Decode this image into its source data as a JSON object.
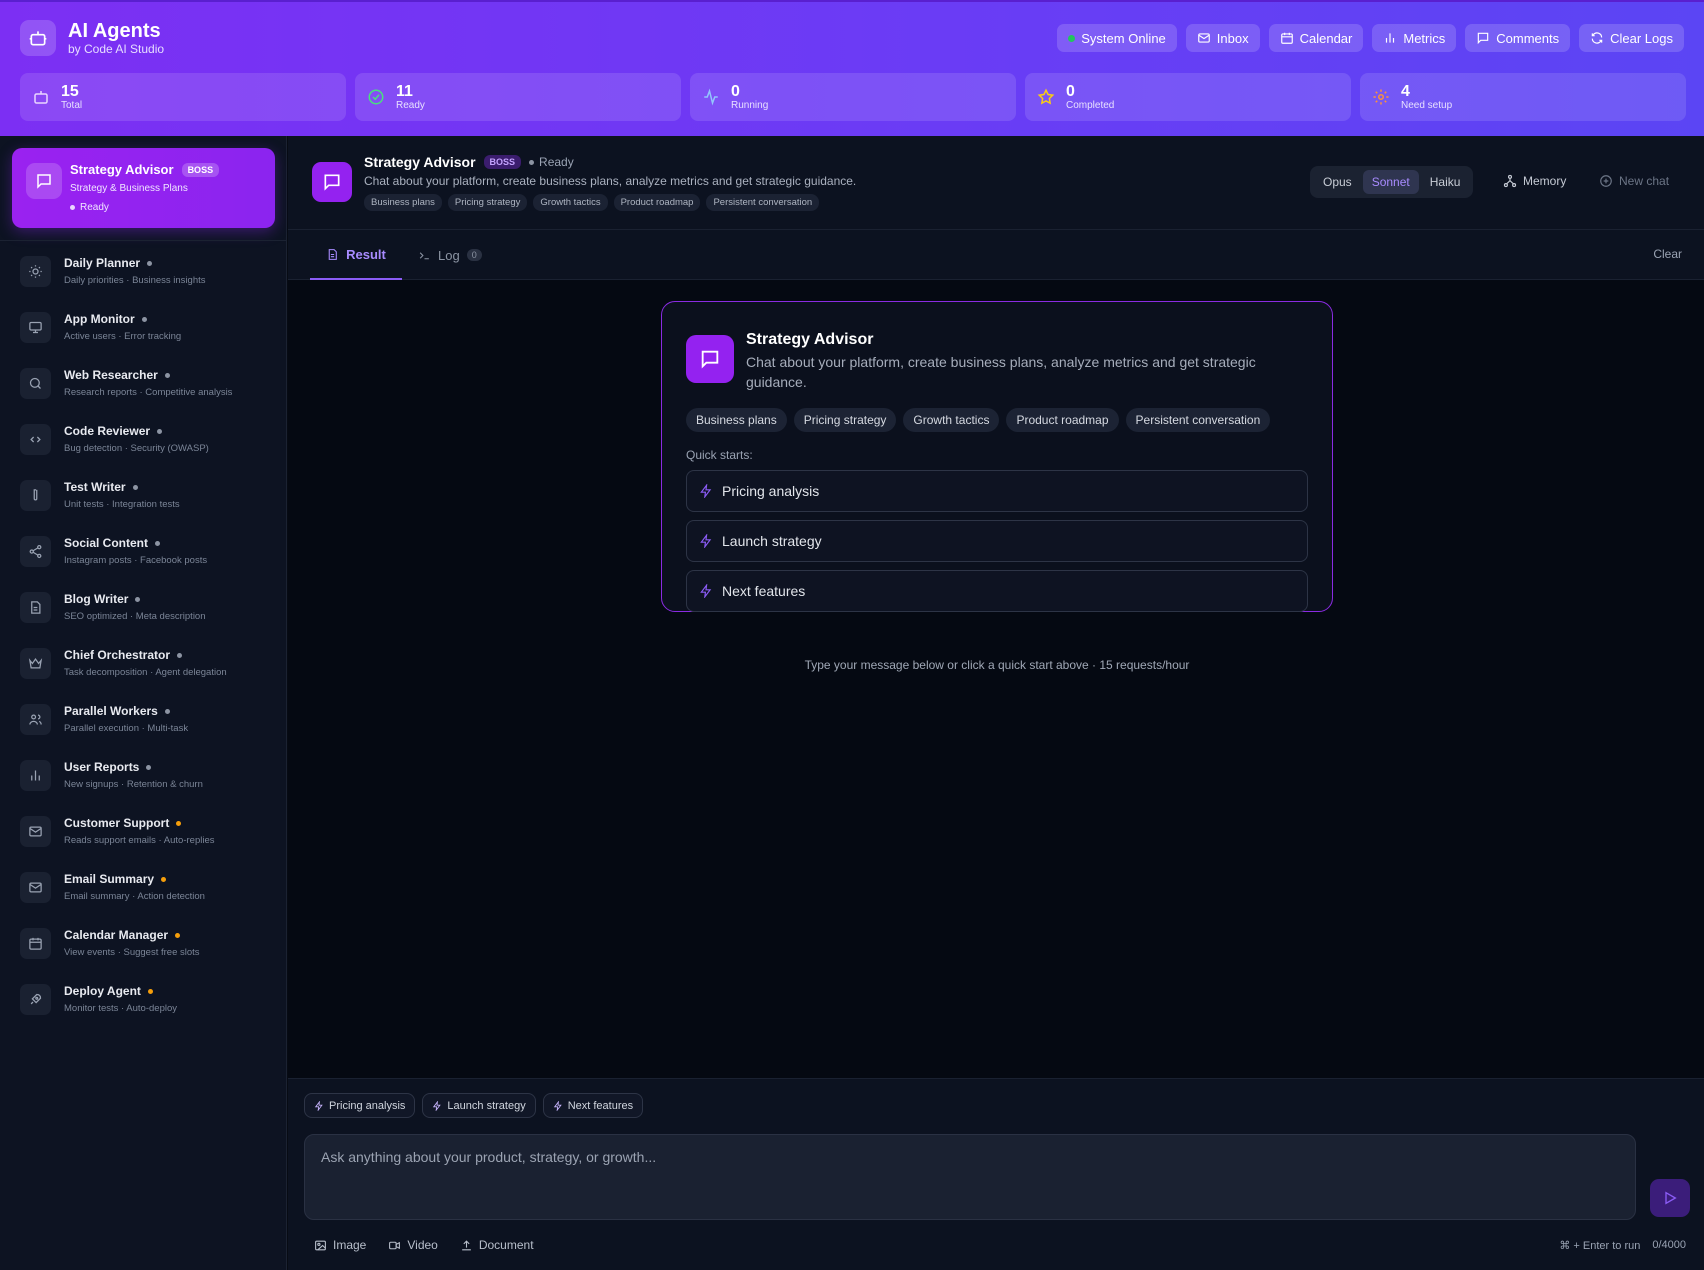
{
  "header": {
    "title": "AI Agents",
    "subtitle": "by Code AI Studio",
    "buttons": [
      {
        "label": "System Online",
        "icon": "status-dot"
      },
      {
        "label": "Inbox",
        "icon": "mail-icon"
      },
      {
        "label": "Calendar",
        "icon": "calendar-icon"
      },
      {
        "label": "Metrics",
        "icon": "bar-chart-icon"
      },
      {
        "label": "Comments",
        "icon": "message-icon"
      },
      {
        "label": "Clear Logs",
        "icon": "refresh-icon"
      }
    ],
    "stats": [
      {
        "value": "15",
        "label": "Total",
        "icon": "bot-icon"
      },
      {
        "value": "11",
        "label": "Ready",
        "icon": "check-circle-icon"
      },
      {
        "value": "0",
        "label": "Running",
        "icon": "activity-icon"
      },
      {
        "value": "0",
        "label": "Completed",
        "icon": "star-icon"
      },
      {
        "value": "4",
        "label": "Need setup",
        "icon": "gear-icon"
      }
    ]
  },
  "sidebar": {
    "active": {
      "name": "Strategy Advisor",
      "badge": "BOSS",
      "desc": "Strategy & Business Plans",
      "status": "Ready"
    },
    "agents": [
      {
        "name": "Daily Planner",
        "desc": "Daily priorities · Business insights",
        "status": "ready",
        "icon": "sun-icon"
      },
      {
        "name": "App Monitor",
        "desc": "Active users · Error tracking",
        "status": "ready",
        "icon": "monitor-icon"
      },
      {
        "name": "Web Researcher",
        "desc": "Research reports · Competitive analysis",
        "status": "ready",
        "icon": "search-icon"
      },
      {
        "name": "Code Reviewer",
        "desc": "Bug detection · Security (OWASP)",
        "status": "ready",
        "icon": "code-icon"
      },
      {
        "name": "Test Writer",
        "desc": "Unit tests · Integration tests",
        "status": "ready",
        "icon": "test-tube-icon"
      },
      {
        "name": "Social Content",
        "desc": "Instagram posts · Facebook posts",
        "status": "ready",
        "icon": "share-icon"
      },
      {
        "name": "Blog Writer",
        "desc": "SEO optimized · Meta description",
        "status": "ready",
        "icon": "document-icon"
      },
      {
        "name": "Chief Orchestrator",
        "desc": "Task decomposition · Agent delegation",
        "status": "ready",
        "icon": "crown-icon"
      },
      {
        "name": "Parallel Workers",
        "desc": "Parallel execution · Multi-task",
        "status": "ready",
        "icon": "users-icon"
      },
      {
        "name": "User Reports",
        "desc": "New signups · Retention & churn",
        "status": "ready",
        "icon": "bar-chart-icon"
      },
      {
        "name": "Customer Support",
        "desc": "Reads support emails · Auto-replies",
        "status": "setup",
        "icon": "mail-icon"
      },
      {
        "name": "Email Summary",
        "desc": "Email summary · Action detection",
        "status": "setup",
        "icon": "mail-icon"
      },
      {
        "name": "Calendar Manager",
        "desc": "View events · Suggest free slots",
        "status": "setup",
        "icon": "calendar-icon"
      },
      {
        "name": "Deploy Agent",
        "desc": "Monitor tests · Auto-deploy",
        "status": "setup",
        "icon": "rocket-icon"
      }
    ]
  },
  "topbar": {
    "title": "Strategy Advisor",
    "badge": "BOSS",
    "status": "Ready",
    "desc": "Chat about your platform, create business plans, analyze metrics and get strategic guidance.",
    "tags": [
      "Business plans",
      "Pricing strategy",
      "Growth tactics",
      "Product roadmap",
      "Persistent conversation"
    ],
    "models": [
      "Opus",
      "Sonnet",
      "Haiku"
    ],
    "selected_model": "Sonnet",
    "memory": "Memory",
    "new_chat": "New chat"
  },
  "tabs": {
    "result": "Result",
    "log": "Log",
    "log_count": "0",
    "clear": "Clear"
  },
  "card": {
    "title": "Strategy Advisor",
    "desc": "Chat about your platform, create business plans, analyze metrics and get strategic guidance.",
    "tags": [
      "Business plans",
      "Pricing strategy",
      "Growth tactics",
      "Product roadmap",
      "Persistent conversation"
    ],
    "quick_label": "Quick starts:",
    "quick": [
      "Pricing analysis",
      "Launch strategy",
      "Next features"
    ]
  },
  "hint": "Type your message below or click a quick start above · 15 requests/hour",
  "composer": {
    "chips": [
      "Pricing analysis",
      "Launch strategy",
      "Next features"
    ],
    "placeholder": "Ask anything about your product, strategy, or growth...",
    "attach": [
      "Image",
      "Video",
      "Document"
    ],
    "shortcut": "⌘ + Enter to run",
    "count": "0/4000"
  },
  "colors": {
    "accent": "#9422f0",
    "header_start": "#7c2ff3",
    "header_end": "#5b45f4",
    "ready_dot": "#8c94a3",
    "setup_dot": "#f59e0b",
    "online": "#22c55e"
  }
}
